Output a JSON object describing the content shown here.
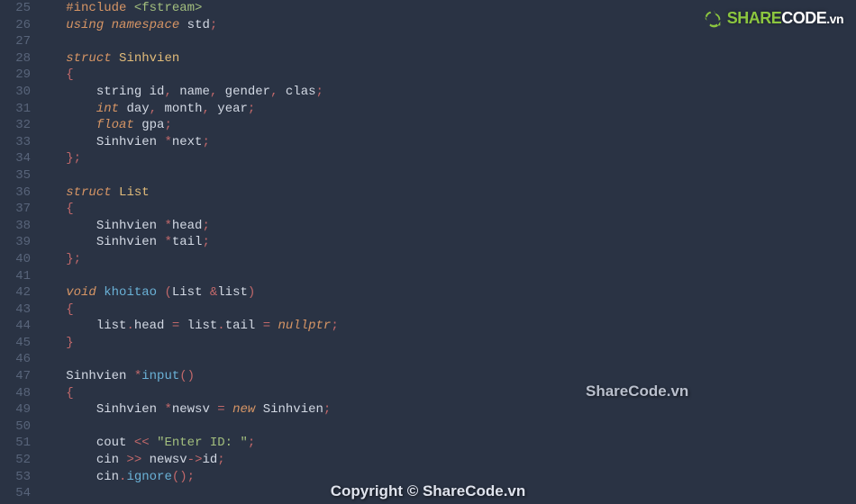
{
  "lineStart": 25,
  "lineEnd": 54,
  "code": {
    "lines": [
      [
        {
          "c": "macro",
          "t": "#include"
        },
        {
          "c": "ident",
          "t": " "
        },
        {
          "c": "incfile",
          "t": "<fstream>"
        }
      ],
      [
        {
          "c": "keyword",
          "t": "using"
        },
        {
          "c": "ident",
          "t": " "
        },
        {
          "c": "keyword",
          "t": "namespace"
        },
        {
          "c": "ident",
          "t": " std"
        },
        {
          "c": "punct",
          "t": ";"
        }
      ],
      [],
      [
        {
          "c": "keyword",
          "t": "struct"
        },
        {
          "c": "ident",
          "t": " "
        },
        {
          "c": "classname",
          "t": "Sinhvien"
        }
      ],
      [
        {
          "c": "punct",
          "t": "{"
        }
      ],
      [
        {
          "c": "ident",
          "t": "    string id"
        },
        {
          "c": "punct",
          "t": ","
        },
        {
          "c": "ident",
          "t": " name"
        },
        {
          "c": "punct",
          "t": ","
        },
        {
          "c": "ident",
          "t": " gender"
        },
        {
          "c": "punct",
          "t": ","
        },
        {
          "c": "ident",
          "t": " clas"
        },
        {
          "c": "punct",
          "t": ";"
        }
      ],
      [
        {
          "c": "ident",
          "t": "    "
        },
        {
          "c": "type",
          "t": "int"
        },
        {
          "c": "ident",
          "t": " day"
        },
        {
          "c": "punct",
          "t": ","
        },
        {
          "c": "ident",
          "t": " month"
        },
        {
          "c": "punct",
          "t": ","
        },
        {
          "c": "ident",
          "t": " year"
        },
        {
          "c": "punct",
          "t": ";"
        }
      ],
      [
        {
          "c": "ident",
          "t": "    "
        },
        {
          "c": "type",
          "t": "float"
        },
        {
          "c": "ident",
          "t": " gpa"
        },
        {
          "c": "punct",
          "t": ";"
        }
      ],
      [
        {
          "c": "ident",
          "t": "    Sinhvien "
        },
        {
          "c": "punct",
          "t": "*"
        },
        {
          "c": "ident",
          "t": "next"
        },
        {
          "c": "punct",
          "t": ";"
        }
      ],
      [
        {
          "c": "punct",
          "t": "};"
        }
      ],
      [],
      [
        {
          "c": "keyword",
          "t": "struct"
        },
        {
          "c": "ident",
          "t": " "
        },
        {
          "c": "classname",
          "t": "List"
        }
      ],
      [
        {
          "c": "punct",
          "t": "{"
        }
      ],
      [
        {
          "c": "ident",
          "t": "    Sinhvien "
        },
        {
          "c": "punct",
          "t": "*"
        },
        {
          "c": "ident",
          "t": "head"
        },
        {
          "c": "punct",
          "t": ";"
        }
      ],
      [
        {
          "c": "ident",
          "t": "    Sinhvien "
        },
        {
          "c": "punct",
          "t": "*"
        },
        {
          "c": "ident",
          "t": "tail"
        },
        {
          "c": "punct",
          "t": ";"
        }
      ],
      [
        {
          "c": "punct",
          "t": "};"
        }
      ],
      [],
      [
        {
          "c": "type",
          "t": "void"
        },
        {
          "c": "ident",
          "t": " "
        },
        {
          "c": "func",
          "t": "khoitao"
        },
        {
          "c": "ident",
          "t": " "
        },
        {
          "c": "punct",
          "t": "("
        },
        {
          "c": "ident",
          "t": "List "
        },
        {
          "c": "punct",
          "t": "&"
        },
        {
          "c": "ident",
          "t": "list"
        },
        {
          "c": "punct",
          "t": ")"
        }
      ],
      [
        {
          "c": "punct",
          "t": "{"
        }
      ],
      [
        {
          "c": "ident",
          "t": "    list"
        },
        {
          "c": "punct",
          "t": "."
        },
        {
          "c": "ident",
          "t": "head "
        },
        {
          "c": "punct",
          "t": "="
        },
        {
          "c": "ident",
          "t": " list"
        },
        {
          "c": "punct",
          "t": "."
        },
        {
          "c": "ident",
          "t": "tail "
        },
        {
          "c": "punct",
          "t": "="
        },
        {
          "c": "ident",
          "t": " "
        },
        {
          "c": "null",
          "t": "nullptr"
        },
        {
          "c": "punct",
          "t": ";"
        }
      ],
      [
        {
          "c": "punct",
          "t": "}"
        }
      ],
      [],
      [
        {
          "c": "ident",
          "t": "Sinhvien "
        },
        {
          "c": "punct",
          "t": "*"
        },
        {
          "c": "func",
          "t": "input"
        },
        {
          "c": "punct",
          "t": "()"
        }
      ],
      [
        {
          "c": "punct",
          "t": "{"
        }
      ],
      [
        {
          "c": "ident",
          "t": "    Sinhvien "
        },
        {
          "c": "punct",
          "t": "*"
        },
        {
          "c": "ident",
          "t": "newsv "
        },
        {
          "c": "punct",
          "t": "="
        },
        {
          "c": "ident",
          "t": " "
        },
        {
          "c": "keyword",
          "t": "new"
        },
        {
          "c": "ident",
          "t": " Sinhvien"
        },
        {
          "c": "punct",
          "t": ";"
        }
      ],
      [],
      [
        {
          "c": "ident",
          "t": "    cout "
        },
        {
          "c": "punct",
          "t": "<<"
        },
        {
          "c": "ident",
          "t": " "
        },
        {
          "c": "string",
          "t": "\"Enter ID: \""
        },
        {
          "c": "punct",
          "t": ";"
        }
      ],
      [
        {
          "c": "ident",
          "t": "    cin "
        },
        {
          "c": "punct",
          "t": ">>"
        },
        {
          "c": "ident",
          "t": " newsv"
        },
        {
          "c": "punct",
          "t": "->"
        },
        {
          "c": "ident",
          "t": "id"
        },
        {
          "c": "punct",
          "t": ";"
        }
      ],
      [
        {
          "c": "ident",
          "t": "    cin"
        },
        {
          "c": "punct",
          "t": "."
        },
        {
          "c": "func",
          "t": "ignore"
        },
        {
          "c": "punct",
          "t": "();"
        }
      ],
      []
    ]
  },
  "watermarks": {
    "logoText1": "SHARE",
    "logoText2": "CODE",
    "logoSuffix": ".vn",
    "mid": "ShareCode.vn",
    "bottom": "Copyright © ShareCode.vn"
  }
}
